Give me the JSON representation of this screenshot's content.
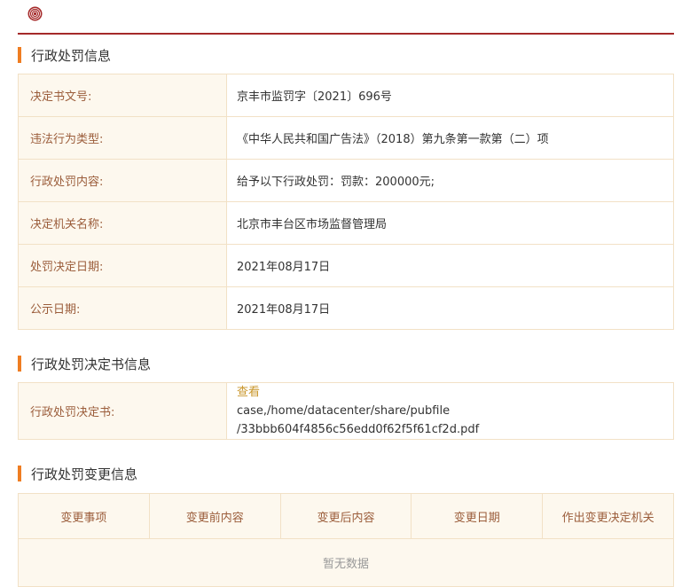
{
  "section1": {
    "title": "行政处罚信息",
    "rows": [
      {
        "label": "决定书文号:",
        "value": "京丰市监罚字〔2021〕696号"
      },
      {
        "label": "违法行为类型:",
        "value": "《中华人民共和国广告法》（2018）第九条第一款第（二）项"
      },
      {
        "label": "行政处罚内容:",
        "value": "给予以下行政处罚：罚款：200000元;"
      },
      {
        "label": "决定机关名称:",
        "value": "北京市丰台区市场监督管理局"
      },
      {
        "label": "处罚决定日期:",
        "value": "2021年08月17日"
      },
      {
        "label": "公示日期:",
        "value": "2021年08月17日"
      }
    ]
  },
  "section2": {
    "title": "行政处罚决定书信息",
    "label": "行政处罚决定书:",
    "view_link": "查看",
    "path_line1": "case,/home/datacenter/share/pubfile",
    "path_line2": "/33bbb604f4856c56edd0f62f5f61cf2d.pdf"
  },
  "section3": {
    "title": "行政处罚变更信息",
    "headers": [
      "变更事项",
      "变更前内容",
      "变更后内容",
      "变更日期",
      "作出变更决定机关"
    ],
    "empty_text": "暂无数据"
  },
  "colors": {
    "accent_bar": "#ef7d22",
    "top_line": "#a52a2a",
    "label_bg": "#fdf8ee",
    "label_text": "#9b5d3b",
    "link": "#c9962b"
  },
  "icons": {
    "logo": "seal-logo-icon"
  }
}
